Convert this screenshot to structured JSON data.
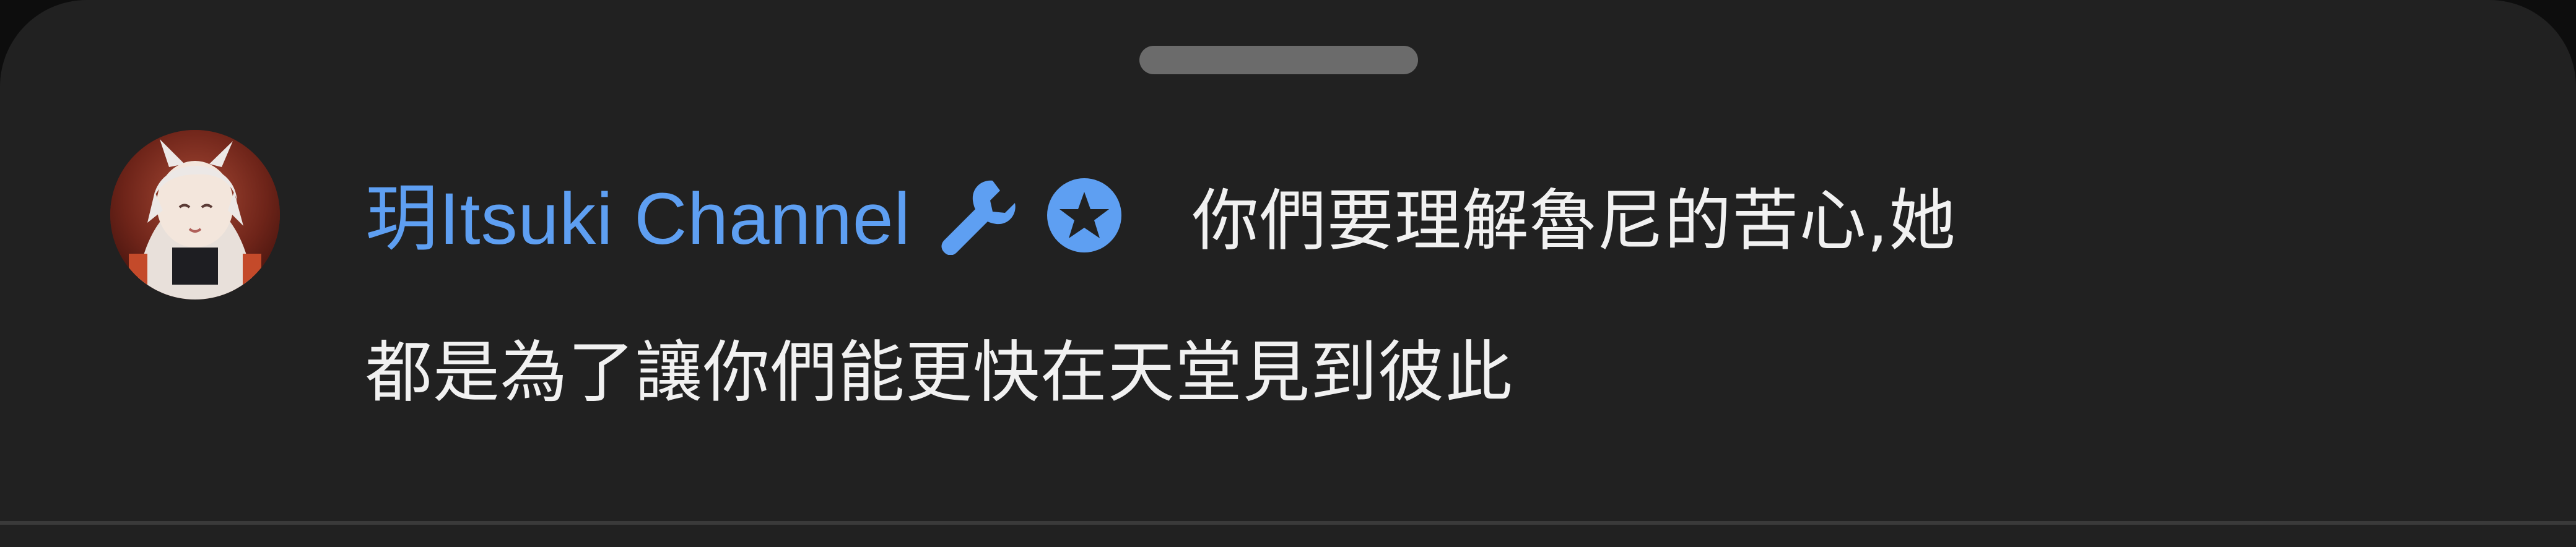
{
  "comment": {
    "author": "玥Itsuki Channel",
    "text_line_1": "你們要理解魯尼的苦心,她",
    "text_line_2": "都是為了讓你們能更快在天堂見到彼此",
    "badges": [
      "wrench-icon",
      "star-circle-icon"
    ]
  },
  "colors": {
    "background": "#212121",
    "author": "#5e9ff2",
    "text": "#f1f1f1",
    "badge": "#5e9ff2",
    "handle": "#6b6b6b"
  }
}
